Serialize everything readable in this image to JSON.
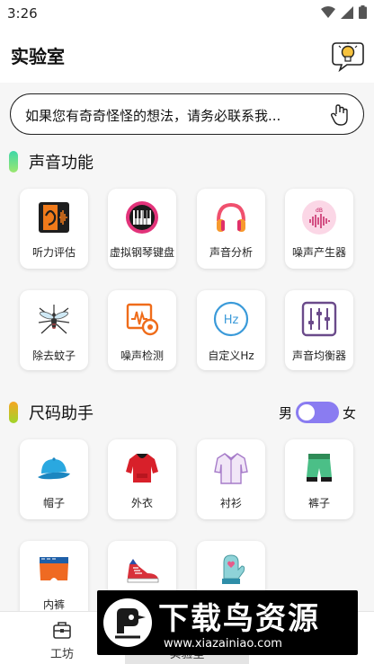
{
  "status": {
    "time": "3:26"
  },
  "header": {
    "title": "实验室"
  },
  "search": {
    "text": "如果您有奇奇怪怪的想法，请务必联系我..."
  },
  "sound": {
    "title": "声音功能",
    "items": [
      {
        "label": "听力评估",
        "icon": "hearing-icon"
      },
      {
        "label": "虚拟钢琴键盘",
        "icon": "piano-icon"
      },
      {
        "label": "声音分析",
        "icon": "headphones-icon"
      },
      {
        "label": "噪声产生器",
        "icon": "noise-generator-icon"
      },
      {
        "label": "除去蚊子",
        "icon": "mosquito-icon"
      },
      {
        "label": "噪声检测",
        "icon": "noise-detect-icon"
      },
      {
        "label": "自定义Hz",
        "icon": "hz-icon"
      },
      {
        "label": "声音均衡器",
        "icon": "equalizer-icon"
      }
    ]
  },
  "size": {
    "title": "尺码助手",
    "male": "男",
    "female": "女",
    "items": [
      {
        "label": "帽子",
        "icon": "cap-icon"
      },
      {
        "label": "外衣",
        "icon": "hoodie-icon"
      },
      {
        "label": "衬衫",
        "icon": "shirt-icon"
      },
      {
        "label": "裤子",
        "icon": "shorts-icon"
      },
      {
        "label": "内裤",
        "icon": "underwear-icon"
      },
      {
        "label": "",
        "icon": "sneaker-icon"
      },
      {
        "label": "",
        "icon": "mitten-icon"
      }
    ]
  },
  "nav": {
    "tabs": [
      {
        "label": "工坊"
      },
      {
        "label": "实验室"
      },
      {
        "label": ""
      }
    ]
  },
  "watermark": {
    "title": "下载鸟资源",
    "url": "www.xiazainiao.com"
  },
  "colors": {
    "accent": "#8a7cf1",
    "sound_bar": "#6fd6a0",
    "size_bar": "#f0b030"
  }
}
